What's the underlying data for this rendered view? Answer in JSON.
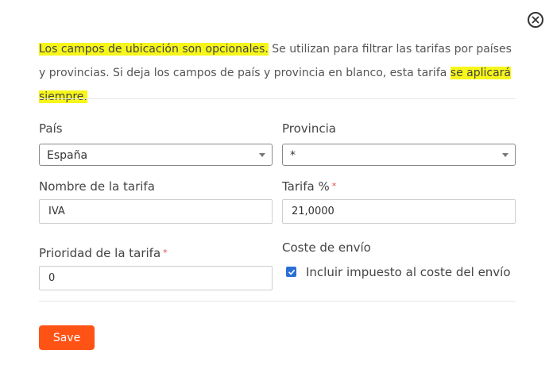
{
  "intro": {
    "part1_highlight": "Los campos de ubicación son opcionales.",
    "part2": " Se utilizan para filtrar las tarifas por países y provincias. Si deja los campos de país y provincia en blanco, esta tarifa ",
    "part3_highlight": "se aplicará siempre. "
  },
  "fields": {
    "country_label": "País",
    "country_value": "España",
    "province_label": "Provincia",
    "province_value": "*",
    "rate_name_label": "Nombre de la tarifa",
    "rate_name_value": "IVA",
    "rate_label": "Tarifa %",
    "rate_value": "21,0000",
    "priority_label": "Prioridad de la tarifa",
    "priority_value": "0",
    "shipping_label": "Coste de envío",
    "shipping_checkbox_label": "Incluir impuesto al coste del envío",
    "required_mark": "*"
  },
  "actions": {
    "save_label": "Save"
  },
  "icons": {
    "close": "close-circle-icon",
    "checkbox": "check-icon",
    "dropdown": "caret-down-icon"
  },
  "colors": {
    "highlight": "#f6f61a",
    "save_button": "#ff5316",
    "checkbox": "#2b6fd6",
    "required": "#e34c4c"
  }
}
